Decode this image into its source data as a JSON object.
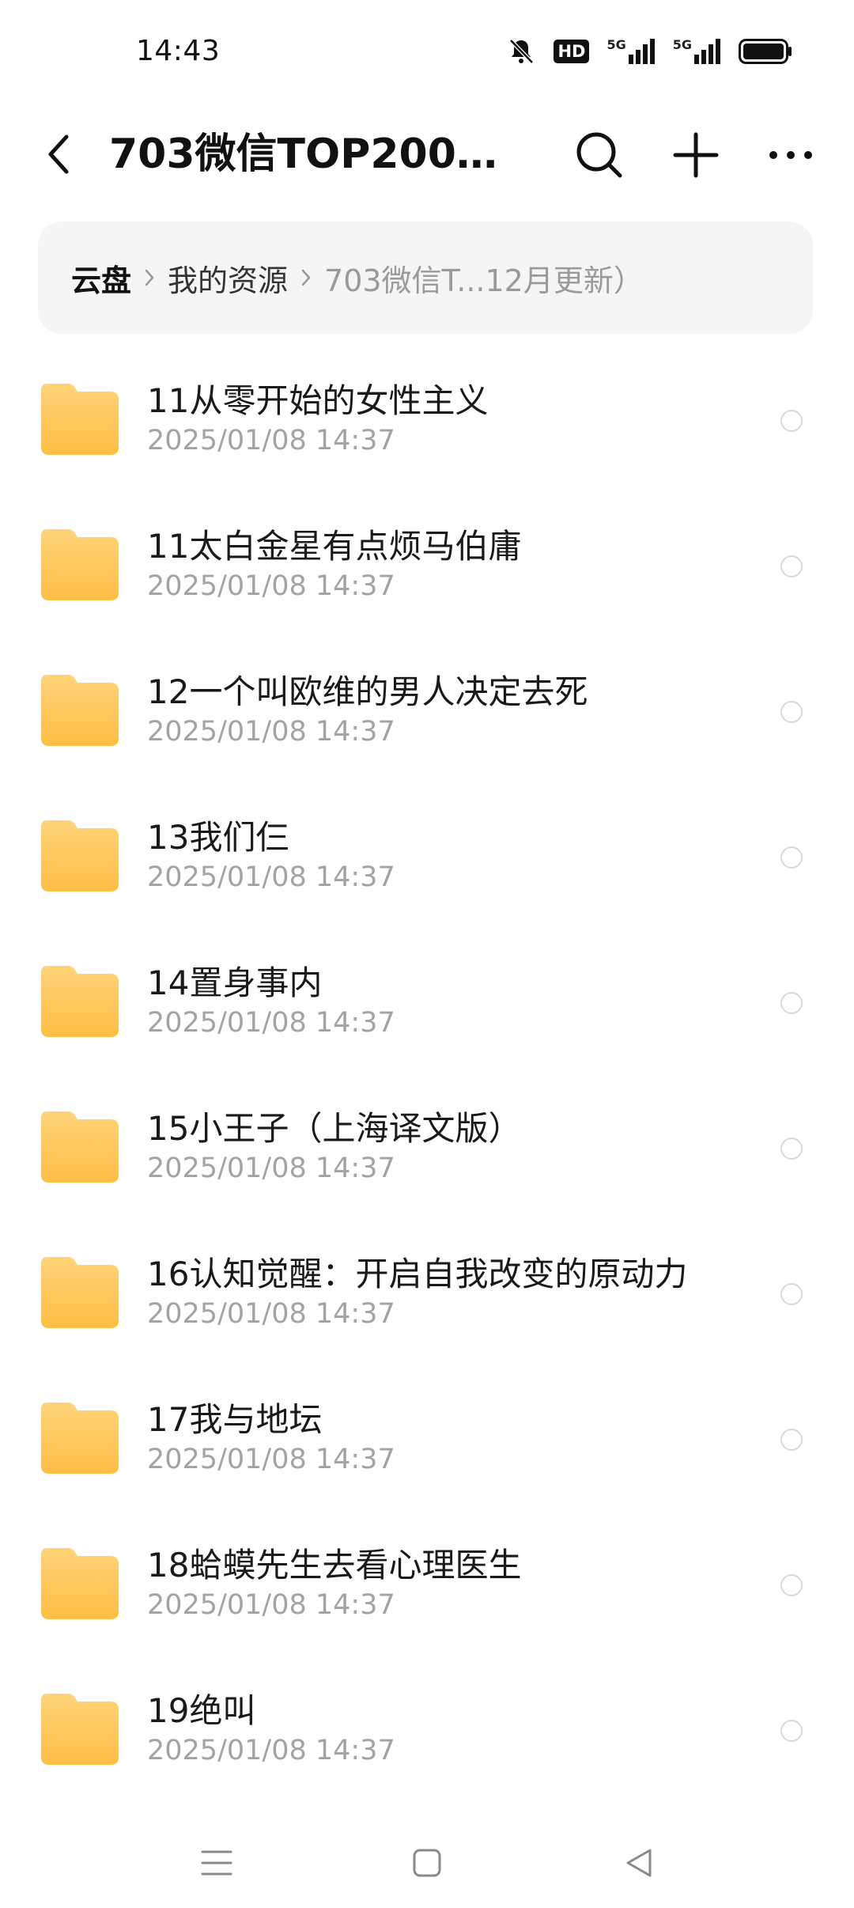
{
  "status": {
    "time": "14:43",
    "hd_label": "HD",
    "net1": "5G",
    "net2": "5G"
  },
  "header": {
    "title": "703微信TOP200书...",
    "back_icon": "chevron-left-icon",
    "search_icon": "search-icon",
    "add_icon": "plus-icon",
    "more_icon": "more-horizontal-icon"
  },
  "breadcrumb": {
    "root": "云盘",
    "level1": "我的资源",
    "current": "703微信T...12月更新）"
  },
  "files": [
    {
      "name": "11从零开始的女性主义",
      "date": "2025/01/08 14:37"
    },
    {
      "name": "11太白金星有点烦马伯庸",
      "date": "2025/01/08 14:37"
    },
    {
      "name": "12一个叫欧维的男人决定去死",
      "date": "2025/01/08 14:37"
    },
    {
      "name": "13我们仨",
      "date": "2025/01/08 14:37"
    },
    {
      "name": "14置身事内",
      "date": "2025/01/08 14:37"
    },
    {
      "name": "15小王子（上海译文版）",
      "date": "2025/01/08 14:37"
    },
    {
      "name": "16认知觉醒：开启自我改变的原动力",
      "date": "2025/01/08 14:37"
    },
    {
      "name": "17我与地坛",
      "date": "2025/01/08 14:37"
    },
    {
      "name": "18蛤蟆先生去看心理医生",
      "date": "2025/01/08 14:37"
    },
    {
      "name": "19绝叫",
      "date": "2025/01/08 14:37"
    }
  ],
  "colors": {
    "folder_top": "#FFD37A",
    "folder_bottom": "#FFBE45",
    "breadcrumb_bg": "#F5F5F5",
    "date_text": "#A3A3A3"
  }
}
